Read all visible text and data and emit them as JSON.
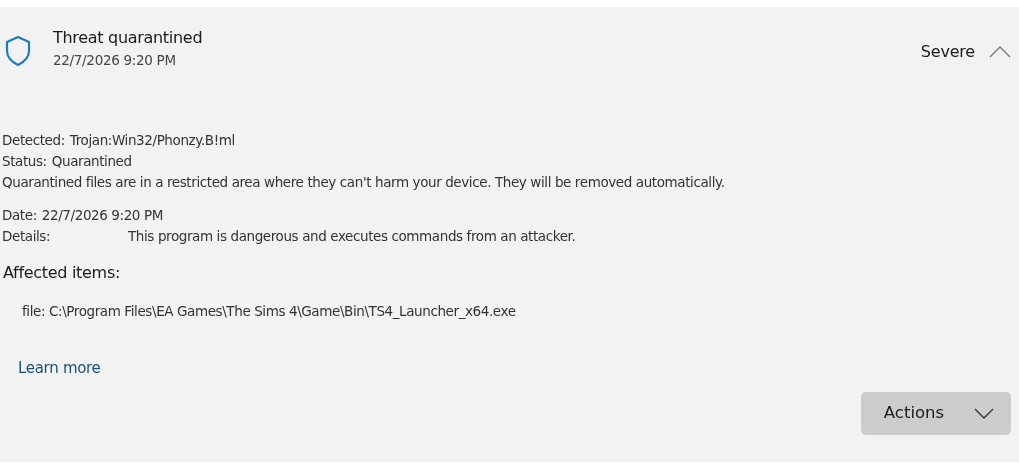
{
  "header": {
    "title": "Threat quarantined",
    "timestamp": "22/7/2026 9:20 PM",
    "severity": "Severe",
    "expanded": true
  },
  "summary": [
    {
      "label": "Detected:",
      "value": "Trojan:Win32/Phonzy.B!ml",
      "kind": "inline"
    },
    {
      "label": "Status:",
      "value": "Quarantined",
      "kind": "inline"
    }
  ],
  "note": "Quarantined files are in a restricted area where they can't harm your device. They will be removed automatically.",
  "info": [
    {
      "label": "Date:",
      "value": "22/7/2026 9:20 PM",
      "kind": "inline"
    },
    {
      "label": "Details:",
      "value": "This program is dangerous and executes commands from an attacker.",
      "kind": "column"
    }
  ],
  "affected": {
    "heading": "Affected items:",
    "items": [
      "file: C:\\Program Files\\EA Games\\The Sims 4\\Game\\Bin\\TS4_Launcher_x64.exe"
    ]
  },
  "learn_more": "Learn more",
  "actions_button": "Actions"
}
